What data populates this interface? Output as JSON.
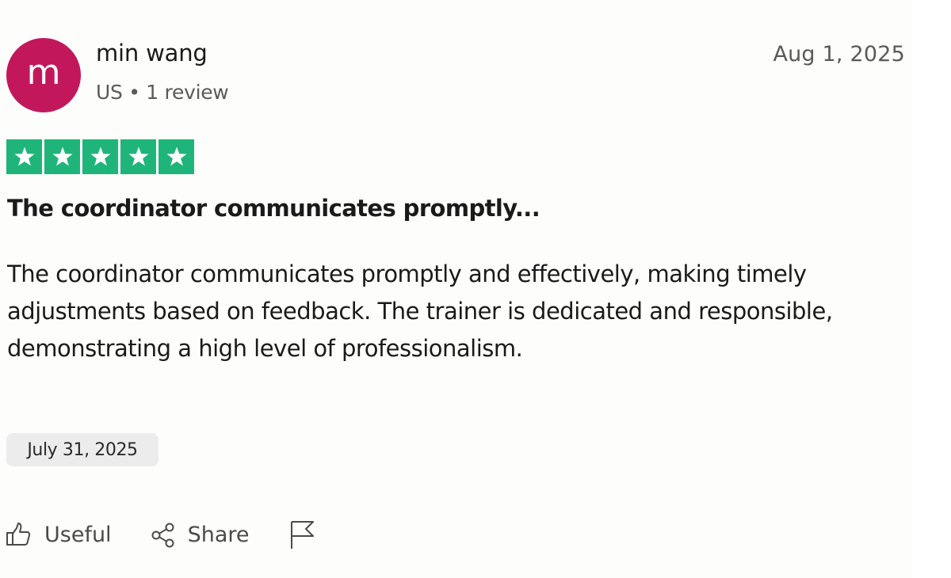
{
  "reviewer": {
    "initial": "m",
    "name": "min wang",
    "meta": "US • 1 review",
    "avatar_color": "#c2185b"
  },
  "review": {
    "date": "Aug 1, 2025",
    "rating": 5,
    "rating_max": 5,
    "star_color": "#1fb57a",
    "title": "The coordinator communicates promptly...",
    "body": "The coordinator communicates promptly and effectively, making timely adjustments based on feedback. The trainer is dedicated and responsible, demonstrating a high level of professionalism.",
    "experience_date": "July 31, 2025"
  },
  "actions": {
    "useful_label": "Useful",
    "share_label": "Share",
    "icons": [
      "thumbs-up-icon",
      "share-icon",
      "flag-icon"
    ]
  }
}
